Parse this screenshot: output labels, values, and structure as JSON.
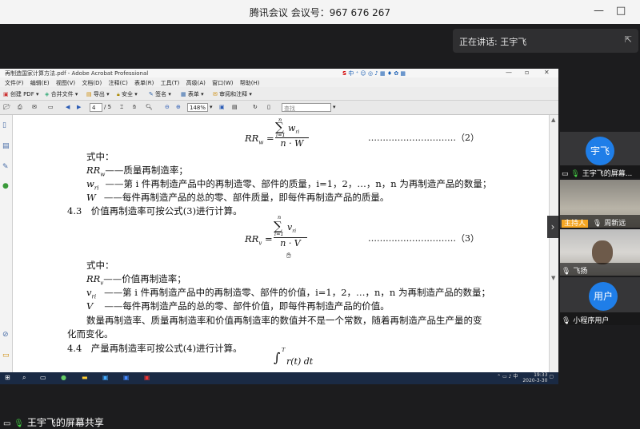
{
  "meeting": {
    "title": "腾讯会议 会议号：967 676 267",
    "minimize": "—",
    "maximize": "□",
    "speaking_label": "正在讲话: 王宇飞"
  },
  "acrobat": {
    "window_title": "再制造国家计算方法.pdf - Adobe Acrobat Professional",
    "menu": [
      "文件(F)",
      "编辑(E)",
      "视图(V)",
      "文档(D)",
      "注释(C)",
      "表单(R)",
      "工具(T)",
      "高级(A)",
      "窗口(W)",
      "帮助(H)"
    ],
    "toolbar1": [
      "创建 PDF",
      "合并文件",
      "导出",
      "安全",
      "签名",
      "表单",
      "审阅和注释"
    ],
    "page_current": "4",
    "page_total": "/ 5",
    "zoom": "148%",
    "search_placeholder": "查找",
    "ime_text": "中",
    "ime_s": "S"
  },
  "document": {
    "eq2_lhs": "RR",
    "eq2_lhs_sub": "w",
    "eq2_sum_top": "",
    "eq2_sum_bottom": "i=1",
    "eq2_num": "w",
    "eq2_num_sub": "ri",
    "eq2_den": "n · W",
    "eq2_sum_limit": "n",
    "eq2_tag": "…………………………（2）",
    "where1": "式中：",
    "def_rrw_sym": "RR",
    "def_rrw_sub": "w",
    "def_rrw_text": "——质量再制造率；",
    "def_wri_sym": "w",
    "def_wri_sub": "ri",
    "def_wri_text": "——第 i 件再制造产品中的再制造零、部件的质量，i=1，2，…，n，n 为再制造产品的数量；",
    "def_W_sym": "W",
    "def_W_text": "——每件再制造产品的总的零、部件质量，即每件再制造产品的质量。",
    "sec43": "4.3　价值再制造率可按公式(3)进行计算。",
    "eq3_lhs": "RR",
    "eq3_lhs_sub": "v",
    "eq3_sum_limit": "n",
    "eq3_sum_bottom": "i=1",
    "eq3_num": "v",
    "eq3_num_sub": "ri",
    "eq3_den": "n · V",
    "eq3_tag": "…………………………（3）",
    "where2": "式中：",
    "def_rrv_sym": "RR",
    "def_rrv_sub": "v",
    "def_rrv_text": "——价值再制造率；",
    "def_vri_sym": "v",
    "def_vri_sub": "ri",
    "def_vri_text": "——第 i 件再制造产品中的再制造零、部件的价值，i=1，2，…，n，n 为再制造产品的数量；",
    "def_V_sym": "V",
    "def_V_text": "——每件再制造产品的总的零、部件价值，即每件再制造产品的价值。",
    "para1": "数量再制造率、质量再制造率和价值再制造率的数值并不是一个常数，随着再制造产品生产量的变",
    "para1b": "化而变化。",
    "sec44": "4.4　产量再制造率可按公式(4)进行计算。",
    "eq4_limit": "T",
    "eq4_integrand": "r(t) dt"
  },
  "taskbar": {
    "time": "19:33",
    "date": "2020-3-30",
    "ime": "中"
  },
  "participants": [
    {
      "avatar": "宇飞",
      "name": "王宇飞的屏幕...",
      "role": ""
    },
    {
      "avatar": "",
      "name": "周新远",
      "role": "主持人"
    },
    {
      "avatar": "",
      "name": "飞扬",
      "role": ""
    },
    {
      "avatar": "用户",
      "name": "小程序用户",
      "role": ""
    }
  ],
  "share_label": "王宇飞的屏幕共享",
  "colors": {
    "avatar_blue": "#1f7ee8",
    "host_badge": "#f5a623",
    "taskbar": "#1a2a44"
  }
}
